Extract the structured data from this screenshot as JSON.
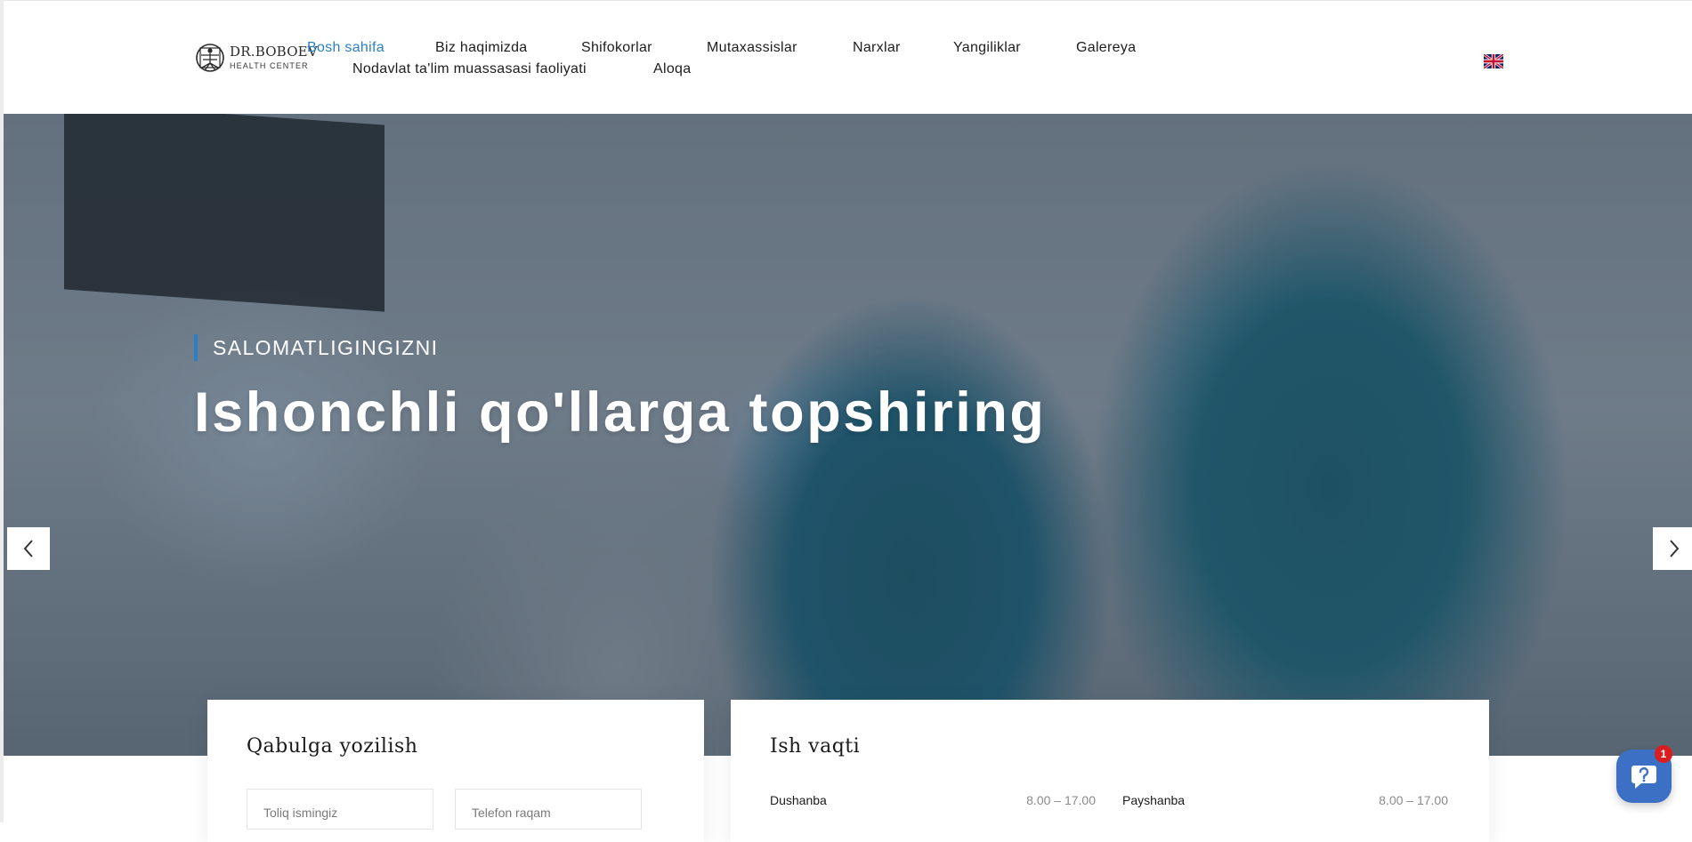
{
  "logo": {
    "brand": "DR.BOBOEV",
    "tagline": "HEALTH CENTER"
  },
  "nav": {
    "items": [
      {
        "label": "Bosh sahifa",
        "active": true
      },
      {
        "label": "Biz haqimizda"
      },
      {
        "label": "Shifokorlar"
      },
      {
        "label": "Mutaxassislar"
      },
      {
        "label": "Narxlar"
      },
      {
        "label": "Yangiliklar"
      },
      {
        "label": "Galereya"
      },
      {
        "label": "Nodavlat ta'lim muassasasi faoliyati"
      },
      {
        "label": "Aloqa"
      }
    ],
    "active_color": "#2a80c6",
    "language_icon": "uk-flag-icon"
  },
  "hero": {
    "eyebrow": "SALOMATLIGINGIZNI",
    "headline": "Ishonchli qo'llarga topshiring",
    "accent_color": "#2a80c6",
    "prev_icon": "chevron-left-icon",
    "next_icon": "chevron-right-icon"
  },
  "appointment": {
    "title": "Qabulga yozilish",
    "name_placeholder": "Toliq ismingiz",
    "phone_placeholder": "Telefon raqam"
  },
  "hours": {
    "title": "Ish vaqti",
    "rows": [
      {
        "day": "Dushanba",
        "time": "8.00 – 17.00"
      },
      {
        "day": "Payshanba",
        "time": "8.00 – 17.00"
      }
    ]
  },
  "chat": {
    "icon": "chat-bubble-icon",
    "badge": "1",
    "color": "#3c70c4"
  }
}
